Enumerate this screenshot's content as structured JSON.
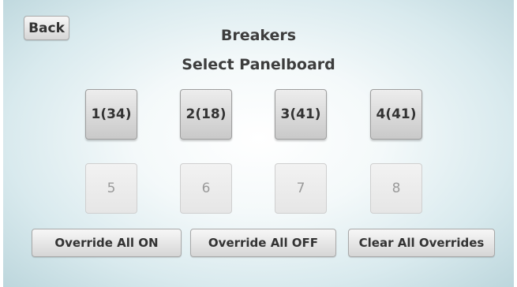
{
  "header": {
    "back_label": "Back",
    "title": "Breakers",
    "subtitle": "Select Panelboard"
  },
  "panels": [
    {
      "label": "1(34)",
      "enabled": true
    },
    {
      "label": "2(18)",
      "enabled": true
    },
    {
      "label": "3(41)",
      "enabled": true
    },
    {
      "label": "4(41)",
      "enabled": true
    },
    {
      "label": "5",
      "enabled": false
    },
    {
      "label": "6",
      "enabled": false
    },
    {
      "label": "7",
      "enabled": false
    },
    {
      "label": "8",
      "enabled": false
    }
  ],
  "actions": {
    "override_on_label": "Override All ON",
    "override_off_label": "Override All OFF",
    "clear_label": "Clear All Overrides"
  }
}
